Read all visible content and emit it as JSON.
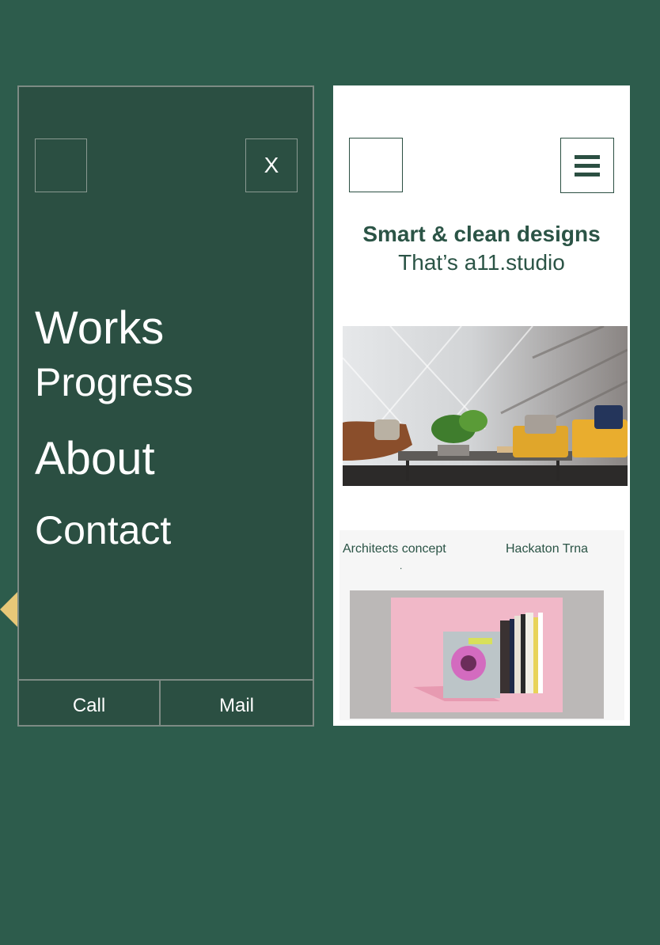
{
  "menu": {
    "close_label": "X",
    "items": [
      {
        "label": "Works"
      },
      {
        "label": "Progress"
      },
      {
        "label": "About"
      },
      {
        "label": "Contact"
      }
    ],
    "footer": {
      "call_label": "Call",
      "mail_label": "Mail"
    }
  },
  "site": {
    "tagline_bold": "Smart & clean designs",
    "tagline_light": "That’s a11.studio",
    "works": [
      {
        "title": "Architects concept"
      },
      {
        "title": "Hackaton Trna"
      }
    ],
    "dot": "."
  },
  "colors": {
    "background": "#2d5c4c",
    "menu_panel": "#2b4f42",
    "accent_arrow": "#e8c878",
    "brand_text": "#2b5446"
  },
  "icons": {
    "close": "close-icon",
    "hamburger": "hamburger-menu-icon",
    "prev": "chevron-left-icon"
  }
}
